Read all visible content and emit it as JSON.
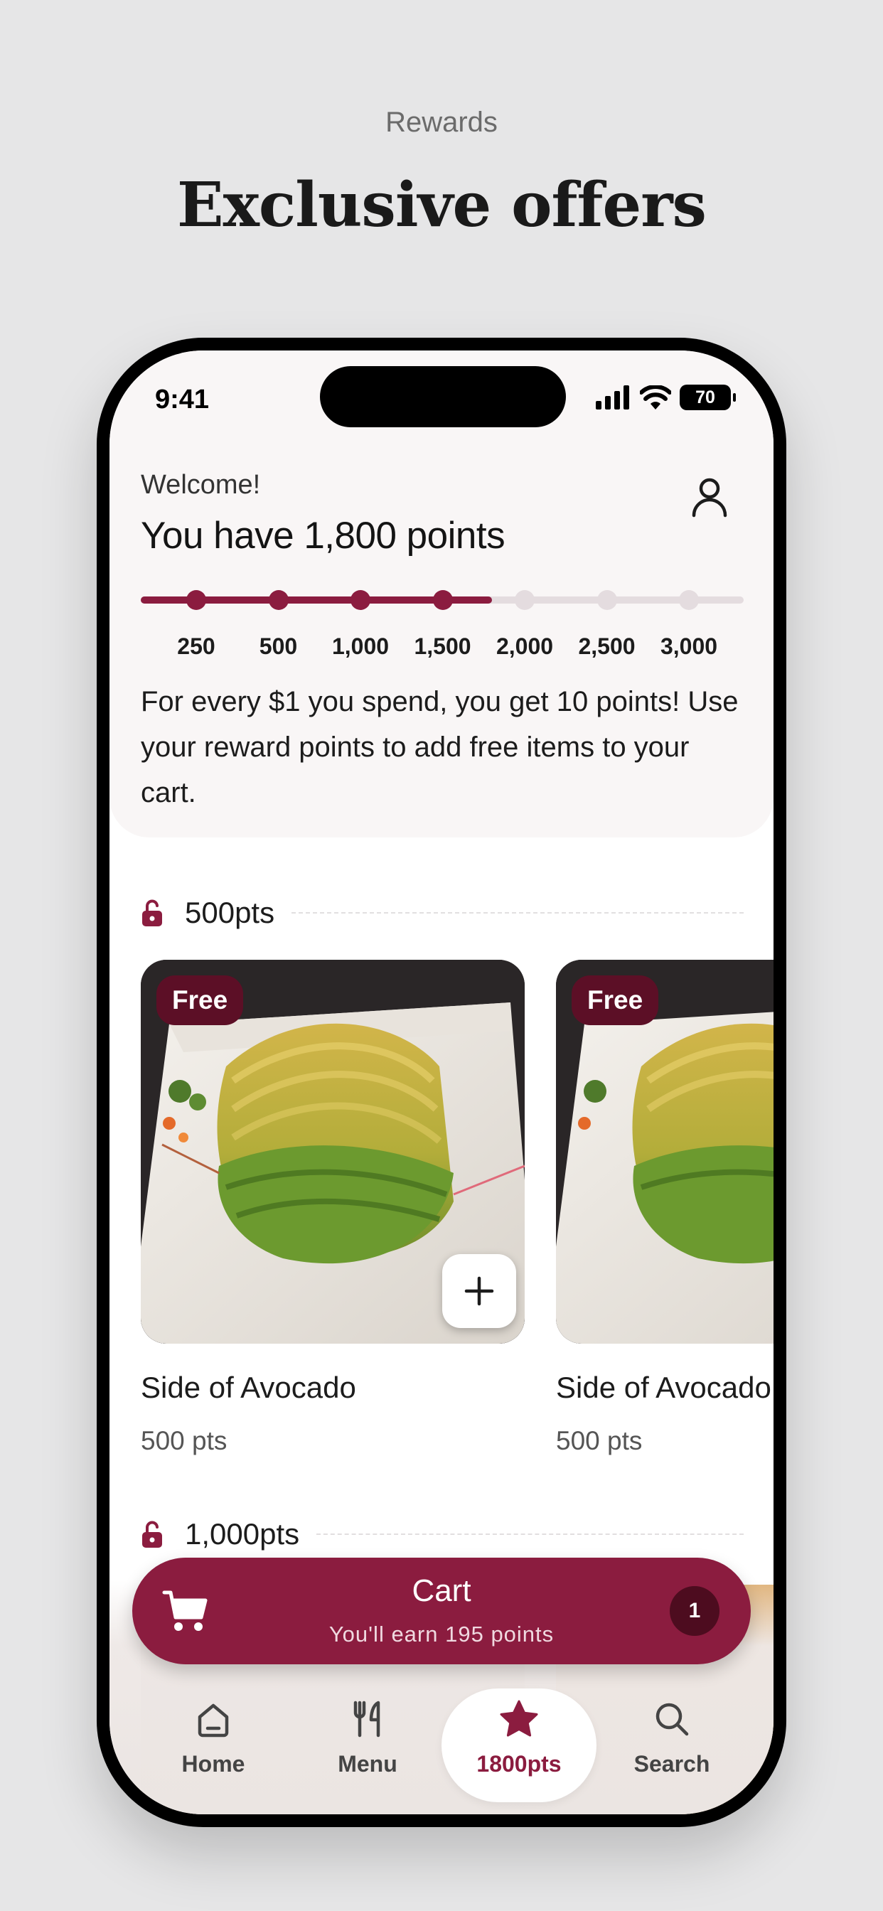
{
  "page": {
    "eyebrow": "Rewards",
    "title": "Exclusive offers"
  },
  "status_bar": {
    "time": "9:41",
    "battery": "70",
    "icons": [
      "signal-icon",
      "wifi-icon",
      "battery-icon"
    ]
  },
  "header": {
    "welcome": "Welcome!",
    "points_title": "You have 1,800 points",
    "description": "For every $1 you spend, you get 10 points! Use your reward points to add free items to your cart.",
    "profile_icon": "user-icon"
  },
  "progress": {
    "current_points": 1800,
    "milestones": [
      {
        "label": "250",
        "reached": true
      },
      {
        "label": "500",
        "reached": true
      },
      {
        "label": "1,000",
        "reached": true
      },
      {
        "label": "1,500",
        "reached": true
      },
      {
        "label": "2,000",
        "reached": false
      },
      {
        "label": "2,500",
        "reached": false
      },
      {
        "label": "3,000",
        "reached": false
      }
    ]
  },
  "tiers": [
    {
      "label": "500pts",
      "icon": "unlock-icon",
      "items": [
        {
          "badge": "Free",
          "name": "Side of Avocado",
          "points": "500 pts",
          "add_icon": "plus-icon"
        },
        {
          "badge": "Free",
          "name": "Side of Avocado",
          "points": "500 pts"
        }
      ]
    },
    {
      "label": "1,000pts",
      "icon": "unlock-icon"
    }
  ],
  "cart": {
    "title": "Cart",
    "subtitle": "You'll earn 195 points",
    "count": "1",
    "icon": "cart-icon"
  },
  "tabs": [
    {
      "label": "Home",
      "icon": "home-icon",
      "active": false
    },
    {
      "label": "Menu",
      "icon": "utensils-icon",
      "active": false
    },
    {
      "label": "1800pts",
      "icon": "star-icon",
      "active": true
    },
    {
      "label": "Search",
      "icon": "search-icon",
      "active": false
    }
  ],
  "colors": {
    "accent": "#8b1c3f",
    "badge": "#5c0f26",
    "track": "#e4dcdf",
    "background": "#e6e6e7"
  }
}
